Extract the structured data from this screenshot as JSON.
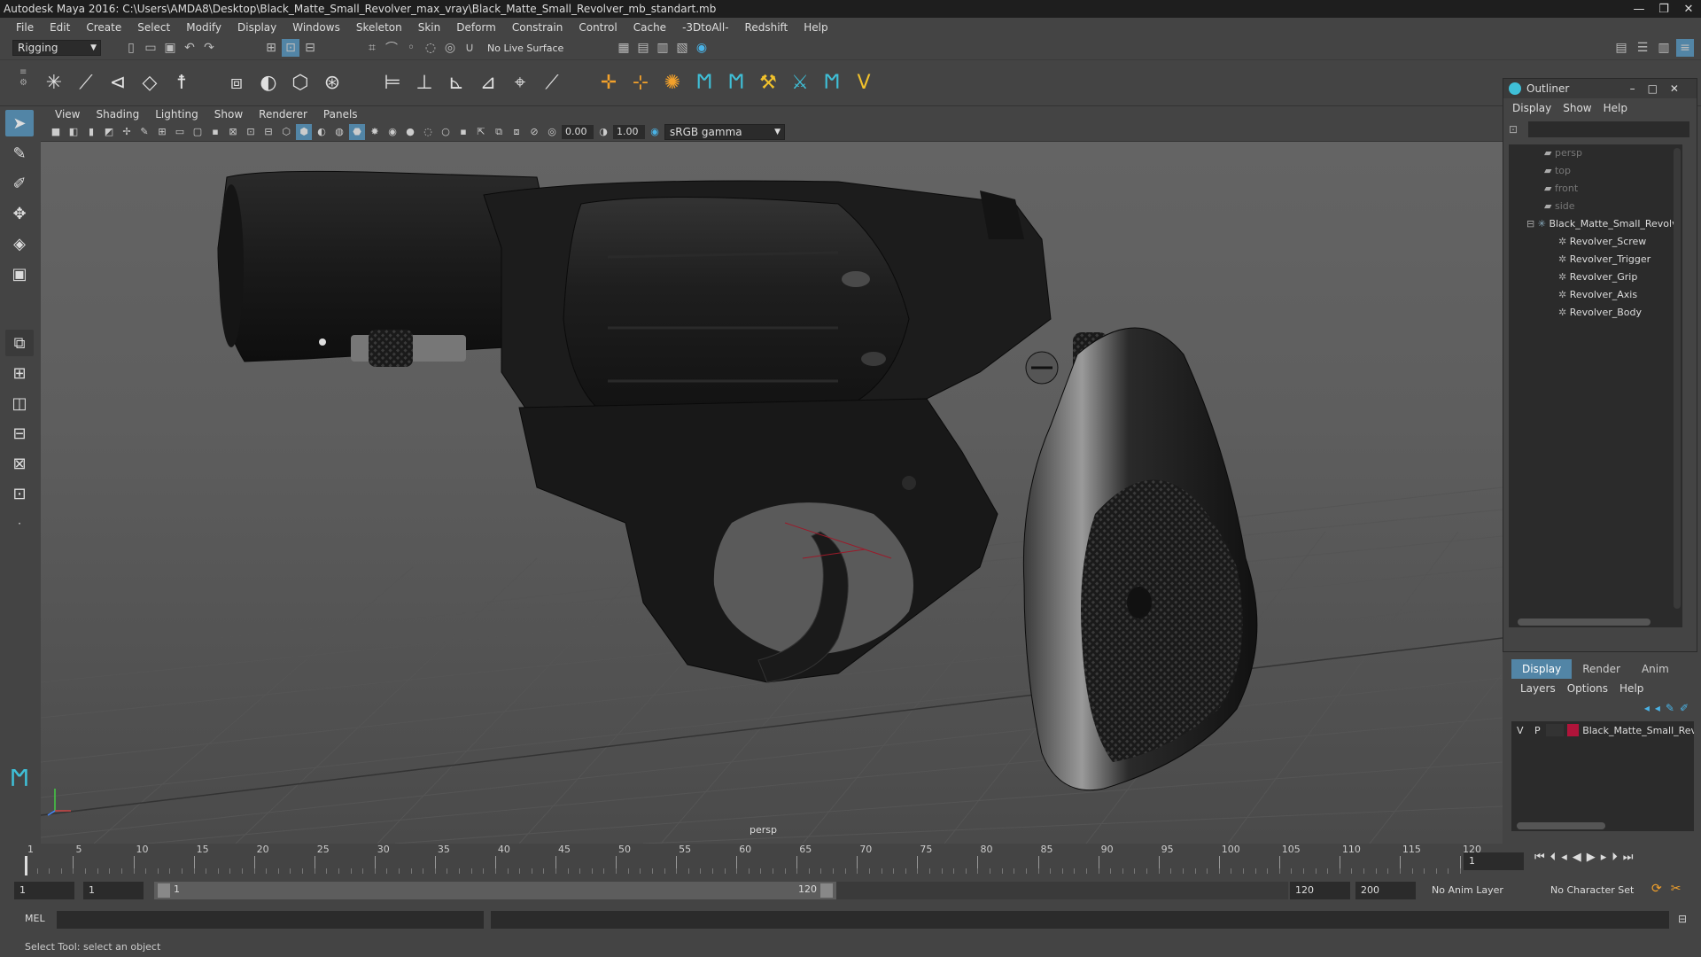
{
  "window": {
    "title": "Autodesk Maya 2016: C:\\Users\\AMDA8\\Desktop\\Black_Matte_Small_Revolver_max_vray\\Black_Matte_Small_Revolver_mb_standart.mb",
    "controls": [
      "—",
      "❐",
      "✕"
    ]
  },
  "menubar": [
    "File",
    "Edit",
    "Create",
    "Select",
    "Modify",
    "Display",
    "Windows",
    "Skeleton",
    "Skin",
    "Deform",
    "Constrain",
    "Control",
    "Cache",
    "-3DtoAll-",
    "Redshift",
    "Help"
  ],
  "toolbar": {
    "mode": "Rigging",
    "live_surface": "No Live Surface"
  },
  "panel_menu": [
    "View",
    "Shading",
    "Lighting",
    "Show",
    "Renderer",
    "Panels"
  ],
  "panel_bar": {
    "exposure": "0.00",
    "gamma": "1.00",
    "color_space": "sRGB gamma"
  },
  "viewport": {
    "camera_label": "persp"
  },
  "outliner": {
    "title": "Outliner",
    "menu": [
      "Display",
      "Show",
      "Help"
    ],
    "cameras": [
      "persp",
      "top",
      "front",
      "side"
    ],
    "root": "Black_Matte_Small_Revolv",
    "children": [
      "Revolver_Screw",
      "Revolver_Trigger",
      "Revolver_Grip",
      "Revolver_Axis",
      "Revolver_Body"
    ]
  },
  "layer_editor": {
    "tabs": [
      "Display",
      "Render",
      "Anim"
    ],
    "menu": [
      "Layers",
      "Options",
      "Help"
    ],
    "layer": {
      "v": "V",
      "p": "P",
      "name": "Black_Matte_Small_Rev",
      "color": "#b0143a"
    }
  },
  "timeline": {
    "ticks": [
      "1",
      "5",
      "10",
      "15",
      "20",
      "25",
      "30",
      "35",
      "40",
      "45",
      "50",
      "55",
      "60",
      "65",
      "70",
      "75",
      "80",
      "85",
      "90",
      "95",
      "100",
      "105",
      "110",
      "115",
      "120"
    ],
    "current_frame": "1"
  },
  "range": {
    "start": "1",
    "playback_start": "1",
    "slider_start": "1",
    "slider_end": "120",
    "playback_end": "120",
    "end": "200",
    "anim_layer": "No Anim Layer",
    "character_set": "No Character Set"
  },
  "mel": {
    "label": "MEL"
  },
  "status": "Select Tool: select an object"
}
